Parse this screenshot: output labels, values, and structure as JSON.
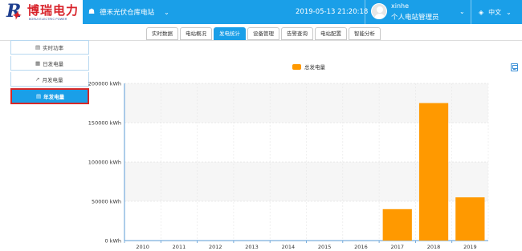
{
  "header": {
    "logo_cn": "博瑞电力",
    "logo_en": "BORUI ELECTRIC POWER",
    "station_name": "德禾光伏仓库电站",
    "datetime": "2019-05-13 21:20:18",
    "user_name": "xinhe",
    "user_role": "个人电站管理员",
    "language": "中文"
  },
  "tabs": [
    {
      "label": "实时数据",
      "active": false
    },
    {
      "label": "电站概况",
      "active": false
    },
    {
      "label": "发电统计",
      "active": true
    },
    {
      "label": "设备管理",
      "active": false
    },
    {
      "label": "告警查询",
      "active": false
    },
    {
      "label": "电站配置",
      "active": false
    },
    {
      "label": "智能分析",
      "active": false
    }
  ],
  "sidebar": {
    "items": [
      {
        "label": "实时功率",
        "icon": "area-chart-icon",
        "active": false
      },
      {
        "label": "日发电量",
        "icon": "bar-chart-icon",
        "active": false
      },
      {
        "label": "月发电量",
        "icon": "line-chart-icon",
        "active": false
      },
      {
        "label": "年发电量",
        "icon": "calendar-icon",
        "active": true
      }
    ]
  },
  "colors": {
    "header_bg": "#1a9fe8",
    "bar": "#ff9900",
    "active_border": "#d62828"
  },
  "chart_data": {
    "type": "bar",
    "title": "",
    "legend": [
      "总发电量"
    ],
    "legend_position": "top-center",
    "categories": [
      "2010",
      "2011",
      "2012",
      "2013",
      "2014",
      "2015",
      "2016",
      "2017",
      "2018",
      "2019"
    ],
    "series": [
      {
        "name": "总发电量",
        "values": [
          0,
          0,
          0,
          0,
          0,
          0,
          0,
          40000,
          175000,
          55000
        ]
      }
    ],
    "y_ticks": [
      "0 kWh",
      "50000 kWh",
      "100000 kWh",
      "150000 kWh",
      "200000 kWh"
    ],
    "ylim": [
      0,
      200000
    ],
    "grid": true
  }
}
